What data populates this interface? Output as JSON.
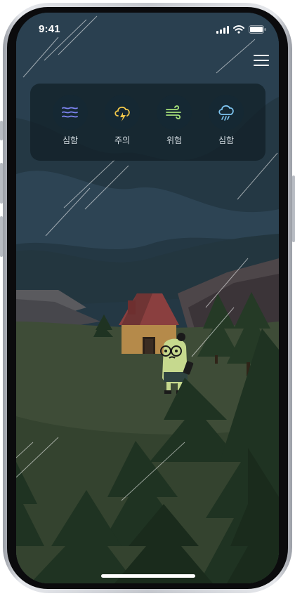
{
  "status_bar": {
    "time": "9:41"
  },
  "alerts": [
    {
      "icon": "fog-icon",
      "label": "심함",
      "color": "#7d84f0"
    },
    {
      "icon": "thunder-cloud-icon",
      "label": "주의",
      "color": "#f2c84a"
    },
    {
      "icon": "wind-icon",
      "label": "위험",
      "color": "#a6e07a"
    },
    {
      "icon": "rain-cloud-icon",
      "label": "심함",
      "color": "#7fc6f2"
    }
  ],
  "scene": {
    "sky_color": "#243844",
    "hill_color": "#3e4c37",
    "tree_color": "#1f3322",
    "house_roof_color": "#8a3f3f",
    "house_wall_color": "#b58a4a"
  }
}
